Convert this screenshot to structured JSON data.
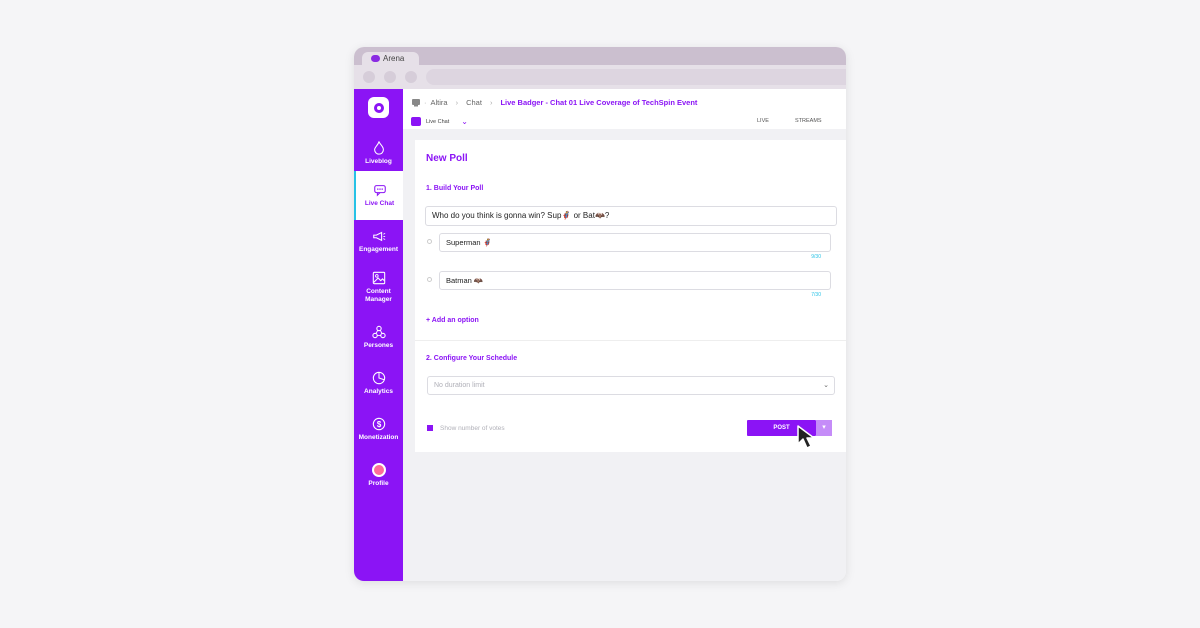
{
  "browser": {
    "tab_title": "Arena"
  },
  "sidebar": {
    "items": [
      {
        "label": "Liveblog",
        "icon": "flame-icon"
      },
      {
        "label": "Live Chat",
        "icon": "chat-icon",
        "active": true
      },
      {
        "label": "Engagement",
        "icon": "megaphone-icon"
      },
      {
        "label": "Content Manager",
        "icon": "image-icon"
      },
      {
        "label": "Persones",
        "icon": "people-icon"
      },
      {
        "label": "Analytics",
        "icon": "pie-chart-icon"
      },
      {
        "label": "Monetization",
        "icon": "dollar-icon"
      },
      {
        "label": "Profile",
        "icon": "avatar"
      }
    ]
  },
  "breadcrumb": {
    "items": [
      "Altira",
      "Chat"
    ],
    "current": "Live Badger - Chat 01 Live Coverage of TechSpin Event"
  },
  "subbar": {
    "selector": "Live Chat",
    "tabs": [
      "LIVE",
      "STREAMS"
    ]
  },
  "poll": {
    "title": "New Poll",
    "section1": "1. Build Your Poll",
    "question": "Who do you think is gonna win? Sup🦸 or Bat🦇?",
    "options": [
      {
        "value": "Superman 🦸",
        "count": "9/30"
      },
      {
        "value": "Batman 🦇",
        "count": "7/30"
      }
    ],
    "add_option": "+ Add an option",
    "section2": "2. Configure Your Schedule",
    "duration_placeholder": "No duration limit",
    "show_votes": "Show number of votes",
    "post_label": "POST"
  },
  "colors": {
    "accent": "#8b14f5",
    "highlight": "#27c2e6"
  }
}
